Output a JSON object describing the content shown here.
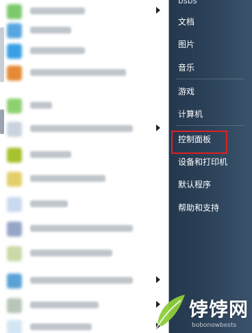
{
  "right_menu": {
    "items": [
      {
        "id": "partial-top",
        "label": "bsbs"
      },
      {
        "id": "documents",
        "label": "文档"
      },
      {
        "id": "pictures",
        "label": "图片"
      },
      {
        "id": "music",
        "label": "音乐"
      },
      {
        "id": "games",
        "label": "游戏"
      },
      {
        "id": "computer",
        "label": "计算机"
      },
      {
        "id": "control-panel",
        "label": "控制面板"
      },
      {
        "id": "devices-printers",
        "label": "设备和打印机"
      },
      {
        "id": "default-programs",
        "label": "默认程序"
      },
      {
        "id": "help-support",
        "label": "帮助和支持"
      }
    ]
  },
  "watermark": {
    "text": "饽饽网",
    "subtext": "bobonowbests"
  },
  "colors": {
    "highlight": "#e02020",
    "right_pane": "#2b4158"
  },
  "icons": {
    "watermark_logo": "leaf-logo",
    "submenu_arrow": "chevron-right-icon"
  }
}
